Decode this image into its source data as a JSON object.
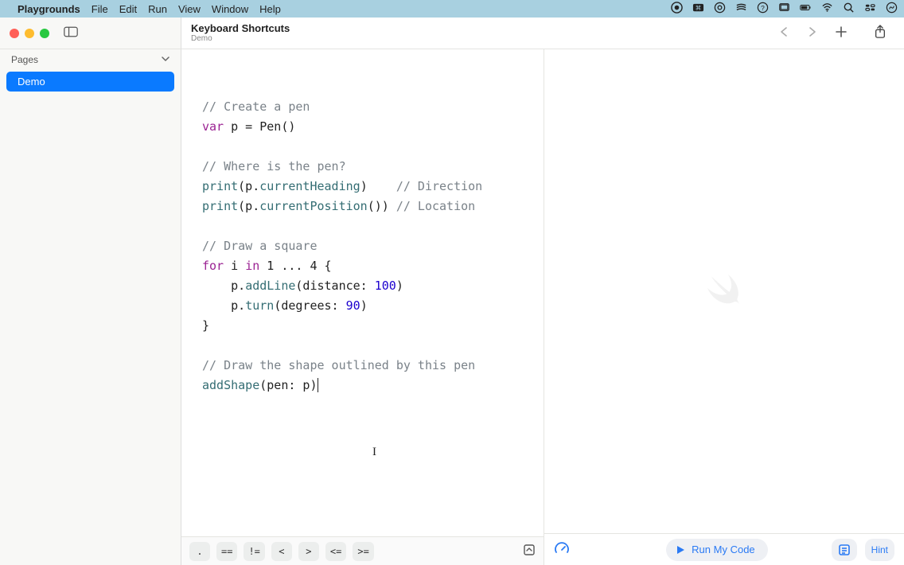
{
  "menubar": {
    "app": "Playgrounds",
    "items": [
      "File",
      "Edit",
      "Run",
      "View",
      "Window",
      "Help"
    ]
  },
  "toolbar": {
    "title": "Keyboard Shortcuts",
    "subtitle": "Demo"
  },
  "sidebar": {
    "header": "Pages",
    "items": [
      {
        "label": "Demo",
        "selected": true
      }
    ]
  },
  "code": {
    "lines": [
      {
        "t": "comment",
        "text": "// Create a pen"
      },
      {
        "t": "var_pen"
      },
      {
        "t": "blank"
      },
      {
        "t": "comment",
        "text": "// Where is the pen?"
      },
      {
        "t": "print_heading"
      },
      {
        "t": "print_position"
      },
      {
        "t": "blank"
      },
      {
        "t": "comment",
        "text": "// Draw a square"
      },
      {
        "t": "for_loop"
      },
      {
        "t": "addline"
      },
      {
        "t": "turn"
      },
      {
        "t": "closebrace"
      },
      {
        "t": "blank"
      },
      {
        "t": "comment",
        "text": "// Draw the shape outlined by this pen"
      },
      {
        "t": "addshape"
      }
    ],
    "tokens": {
      "var": "var",
      "for": "for",
      "in": "in",
      "range": "1 ... 4",
      "pen_init": " p = Pen()",
      "print": "print",
      "heading_line_a": "(p.",
      "heading_prop": "currentHeading",
      "heading_line_b": ")    ",
      "heading_comment": "// Direction",
      "position_line_a": "(p.",
      "position_prop": "currentPosition",
      "position_line_b": "()) ",
      "position_comment": "// Location",
      "addline_a": "    p.",
      "addline_b": "addLine",
      "addline_c": "(distance: ",
      "addline_n": "100",
      "addline_d": ")",
      "turn_a": "    p.",
      "turn_b": "turn",
      "turn_c": "(degrees: ",
      "turn_n": "90",
      "turn_d": ")",
      "close": "}",
      "addshape_a": "addShape",
      "addshape_b": "(pen: p)"
    }
  },
  "operator_bar": [
    ".",
    "==",
    "!=",
    "<",
    ">",
    "<=",
    ">="
  ],
  "footer": {
    "run": "Run My Code",
    "hint": "Hint"
  }
}
